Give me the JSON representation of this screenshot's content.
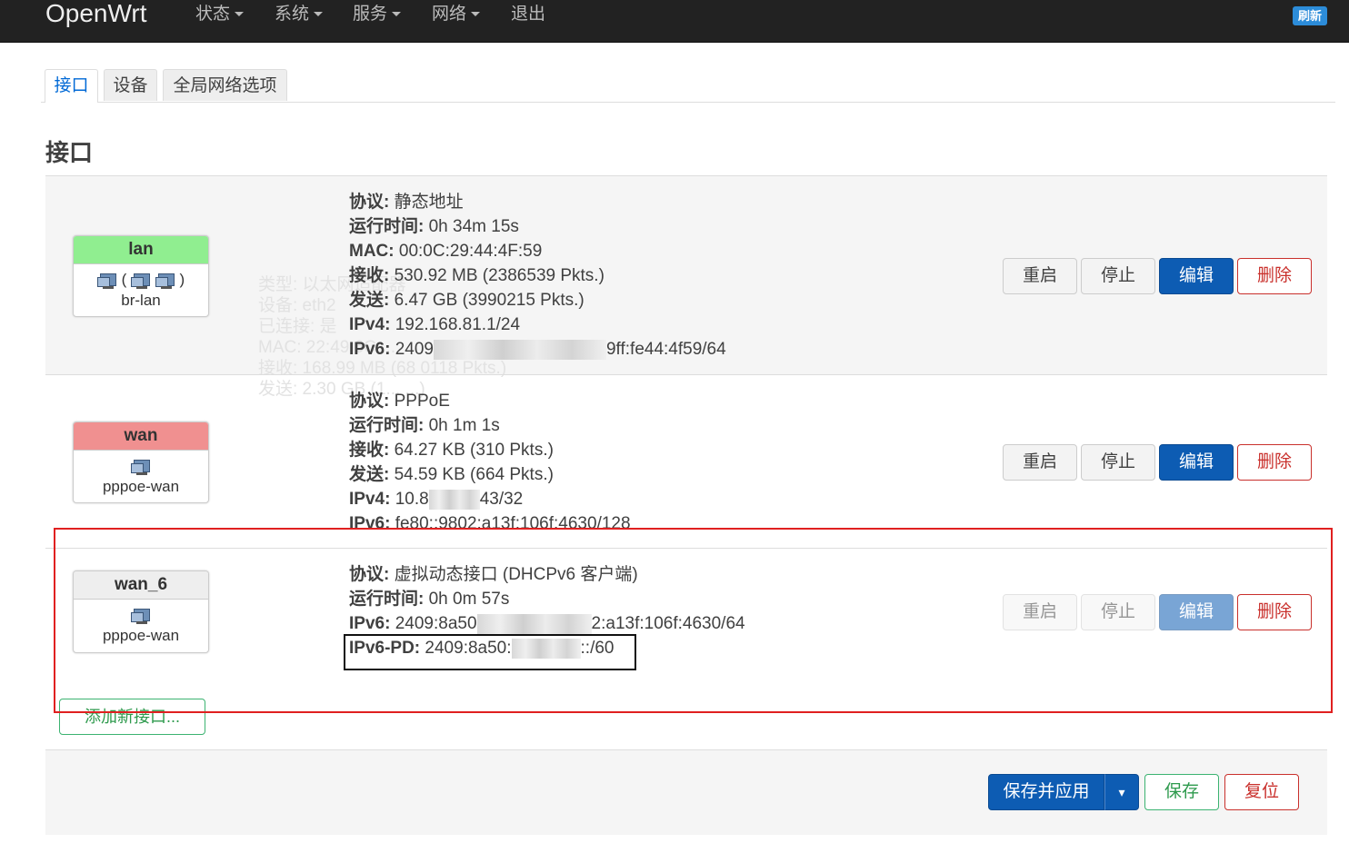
{
  "navbar": {
    "brand": "OpenWrt",
    "menu": [
      {
        "label": "状态",
        "dropdown": true
      },
      {
        "label": "系统",
        "dropdown": true
      },
      {
        "label": "服务",
        "dropdown": true
      },
      {
        "label": "网络",
        "dropdown": true
      },
      {
        "label": "退出",
        "dropdown": false
      }
    ],
    "refresh_badge": "刷新"
  },
  "tabs": [
    {
      "label": "接口",
      "active": true
    },
    {
      "label": "设备",
      "active": false
    },
    {
      "label": "全局网络选项",
      "active": false
    }
  ],
  "section_title": "接口",
  "interfaces": [
    {
      "name": "lan",
      "device": "br-lan",
      "header_color": "#90ee90",
      "info": [
        {
          "key": "协议:",
          "value": "静态地址"
        },
        {
          "key": "运行时间:",
          "value": "0h 34m 15s"
        },
        {
          "key": "MAC:",
          "value": "00:0C:29:44:4F:59"
        },
        {
          "key": "接收:",
          "value": "530.92 MB (2386539 Pkts.)"
        },
        {
          "key": "发送:",
          "value": "6.47 GB (3990215 Pkts.)"
        },
        {
          "key": "IPv4:",
          "value": "192.168.81.1/24"
        },
        {
          "key": "IPv6:",
          "value_prefix": "2409",
          "value_suffix": "9ff:fe44:4f59/64"
        }
      ],
      "ghost_text": [
        "类型: 以太网适配器",
        "设备: eth2",
        "已连接: 是",
        "MAC: 22:49:6C:...",
        "接收: 168.99 MB (68 0118 Pkts.)",
        "发送: 2.30 GB (1... ...)"
      ],
      "buttons": {
        "restart": "重启",
        "stop": "停止",
        "edit": "编辑",
        "delete": "删除"
      },
      "disabled": false
    },
    {
      "name": "wan",
      "device": "pppoe-wan",
      "header_color": "#f09090",
      "info": [
        {
          "key": "协议:",
          "value": "PPPoE"
        },
        {
          "key": "运行时间:",
          "value": "0h 1m 1s"
        },
        {
          "key": "接收:",
          "value": "64.27 KB (310 Pkts.)"
        },
        {
          "key": "发送:",
          "value": "54.59 KB (664 Pkts.)"
        },
        {
          "key": "IPv4:",
          "value_prefix": "10.8",
          "value_suffix": "43/32"
        },
        {
          "key": "IPv6:",
          "value": "fe80::9802:a13f:106f:4630/128"
        }
      ],
      "buttons": {
        "restart": "重启",
        "stop": "停止",
        "edit": "编辑",
        "delete": "删除"
      },
      "disabled": false
    },
    {
      "name": "wan_6",
      "device": "pppoe-wan",
      "header_color": "#eeeeee",
      "info": [
        {
          "key": "协议:",
          "value": "虚拟动态接口 (DHCPv6 客户端)"
        },
        {
          "key": "运行时间:",
          "value": "0h 0m 57s"
        },
        {
          "key": "IPv6:",
          "value_prefix": "2409:8a50",
          "value_suffix": "2:a13f:106f:4630/64"
        },
        {
          "key": "IPv6-PD:",
          "value_prefix": "2409:8a50:",
          "value_suffix": "::/60"
        }
      ],
      "buttons": {
        "restart": "重启",
        "stop": "停止",
        "edit": "编辑",
        "delete": "删除"
      },
      "disabled": true
    }
  ],
  "add_interface_button": "添加新接口...",
  "footer": {
    "save_apply": "保存并应用",
    "dropdown_caret": "▾",
    "save": "保存",
    "reset": "复位"
  }
}
